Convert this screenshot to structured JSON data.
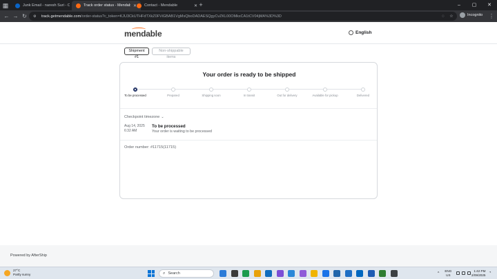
{
  "browser": {
    "tabs": [
      {
        "title": "Junk Email - naresh Suri - Outlo",
        "favicon_color": "#0a64c6",
        "active": false
      },
      {
        "title": "Track order status - Mendable",
        "favicon_color": "#ff6a13",
        "active": true
      },
      {
        "title": "Contact - Mendable",
        "favicon_color": "#ff6a13",
        "active": false
      }
    ],
    "new_tab_icon": "plus-icon",
    "window_controls": {
      "minimize": "–",
      "maximize": "▢",
      "close": "✕"
    },
    "url_host": "track.getmendable.com",
    "url_rest": "/order-status?c_token=KJU3CkUTHFdTXkZ0FViGBAB1VgMsQboDADAESQgyCvZKL00OMkxCA1tCV04jMA%3D%3D",
    "incognito_label": "Incognito",
    "nav": {
      "back": "←",
      "forward": "→",
      "reload": "↻"
    }
  },
  "header": {
    "logo_text": "mendable",
    "language_label": "English"
  },
  "shipments": {
    "active_label": "Shipment #1",
    "inactive_label": "Non-shippable items"
  },
  "order": {
    "title": "Your order is ready to be shipped",
    "steps": [
      {
        "label": "To be processed",
        "current": true
      },
      {
        "label": "Prepared",
        "current": false
      },
      {
        "label": "Shipping soon",
        "current": false
      },
      {
        "label": "In transit",
        "current": false
      },
      {
        "label": "Out for delivery",
        "current": false
      },
      {
        "label": "Available for pickup",
        "current": false
      },
      {
        "label": "Delivered",
        "current": false
      }
    ],
    "checkpoint_timezone_label": "Checkpoint timezone",
    "checkpoint": {
      "date": "Aug 14, 2025",
      "time": "6:32 AM",
      "status": "To be processed",
      "message": "Your order is waiting to be processed"
    },
    "order_number_label": "Order number:",
    "order_number": "#11715(11715)"
  },
  "footer": {
    "powered_by": "Powered by AfterShip"
  },
  "taskbar": {
    "weather_temp": "27°C",
    "weather_desc": "Partly sunny",
    "search_placeholder": "Search",
    "language": "ENG",
    "region": "US",
    "time": "1:42 PM",
    "date": "2/09/2025",
    "app_colors": [
      "#2b7bd8",
      "#3a3a3a",
      "#1c9b4e",
      "#e8a20c",
      "#0f6cbd",
      "#7b4fd6",
      "#2b88d8",
      "#8f5bd8",
      "#f0b400",
      "#1a73e8",
      "#2266aa",
      "#1f6fc4",
      "#0067c0",
      "#1e5cb3",
      "#2f7d32",
      "#3c4043"
    ]
  }
}
